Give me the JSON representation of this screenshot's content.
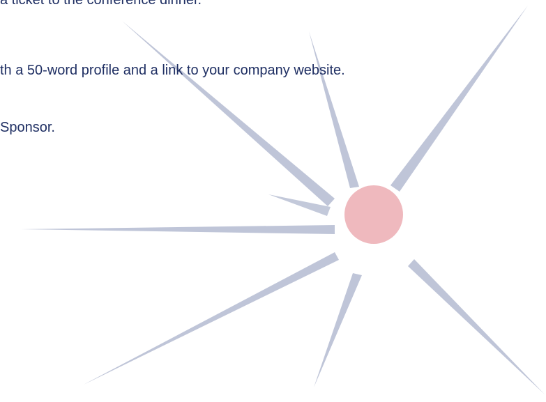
{
  "document": {
    "lines": [
      "a ticket to the conference dinner.",
      "th a 50-word profile and a link to your company website.",
      "Sponsor."
    ]
  },
  "colors": {
    "text": "#1f2f63",
    "ray": "#b8bfd4",
    "center_dot": "#efb9be",
    "background": "#ffffff"
  }
}
